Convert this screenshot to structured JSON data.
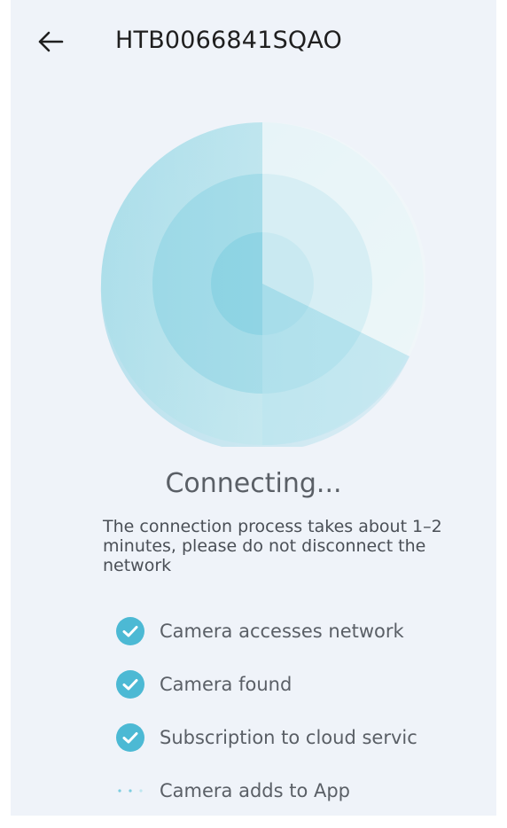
{
  "header": {
    "title": "HTB0066841SQAO",
    "back_icon": "arrow-left-icon"
  },
  "status": {
    "title": "Connecting...",
    "description": "The connection process takes about 1–2 minutes, please do not disconnect the network"
  },
  "steps": [
    {
      "label": "Camera accesses network",
      "state": "done",
      "icon": "check-circle-icon"
    },
    {
      "label": "Camera found",
      "state": "done",
      "icon": "check-circle-icon"
    },
    {
      "label": "Subscription to cloud service",
      "state": "done",
      "icon": "check-circle-icon"
    },
    {
      "label": "Camera adds to App",
      "state": "in-progress",
      "icon": "loading-dots-icon"
    }
  ],
  "colors": {
    "accent": "#4cb9d4",
    "background": "#eff3f9",
    "text_primary": "#1f1f1f",
    "text_secondary": "#5a5f66"
  }
}
